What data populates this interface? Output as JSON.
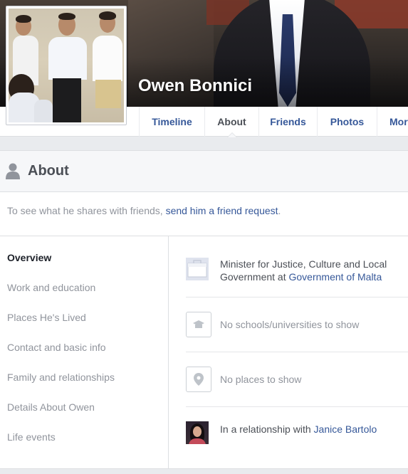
{
  "profile": {
    "name": "Owen Bonnici"
  },
  "nav": {
    "tabs": [
      {
        "label": "Timeline",
        "active": false
      },
      {
        "label": "About",
        "active": true
      },
      {
        "label": "Friends",
        "active": false
      },
      {
        "label": "Photos",
        "active": false
      },
      {
        "label": "Mor",
        "active": false
      }
    ]
  },
  "about": {
    "title": "About",
    "notice_prefix": "To see what he shares with friends, ",
    "notice_link": "send him a friend request",
    "notice_suffix": ".",
    "sidebar": [
      {
        "label": "Overview",
        "active": true
      },
      {
        "label": "Work and education",
        "active": false
      },
      {
        "label": "Places He's Lived",
        "active": false
      },
      {
        "label": "Contact and basic info",
        "active": false
      },
      {
        "label": "Family and relationships",
        "active": false
      },
      {
        "label": "Details About Owen",
        "active": false
      },
      {
        "label": "Life events",
        "active": false
      }
    ],
    "overview": {
      "work_line1": "Minister for Justice, Culture and Local",
      "work_line2_prefix": "Government at ",
      "work_link": "Government of Malta",
      "schools": "No schools/universities to show",
      "places": "No places to show",
      "relationship_prefix": "In a relationship with ",
      "relationship_link": "Janice Bartolo"
    },
    "icons": {
      "header": "person-icon",
      "work": "briefcase-icon",
      "school": "graduation-cap-icon",
      "places": "map-pin-icon"
    }
  },
  "colors": {
    "link": "#365899",
    "text": "#4b4f56",
    "muted": "#90949c",
    "border": "#dddfe2",
    "page_bg": "#e9ebee"
  }
}
